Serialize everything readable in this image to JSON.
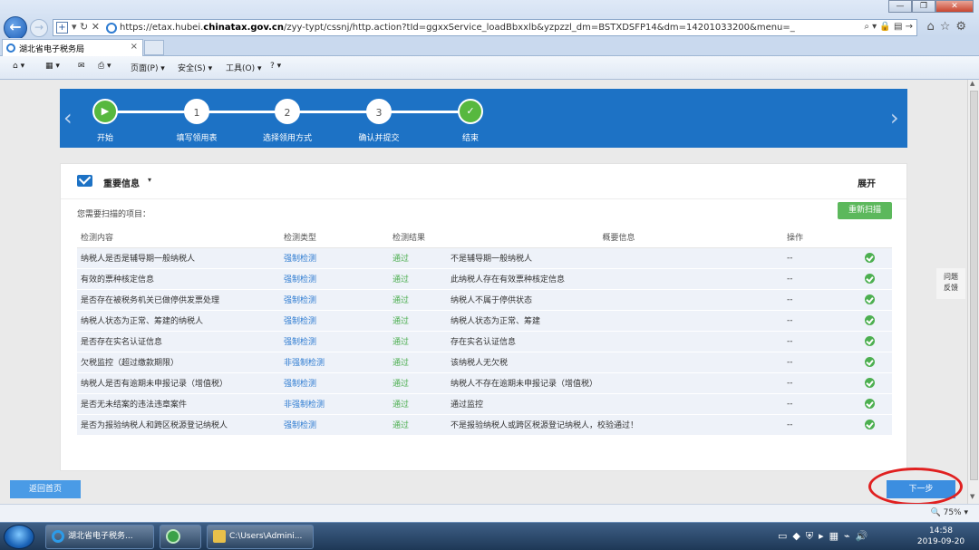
{
  "browser": {
    "url_prefix": "https://etax.hubei.",
    "url_domain": "chinatax.gov.cn",
    "url_suffix": "/zyy-typt/cssnj/http.action?tId=ggxxService_loadBbxxlb&yzpzzl_dm=BSTXDSFP14&dm=14201033200&menu=_",
    "tab_title": "湖北省电子税务局",
    "tab_close": "×",
    "commands": {
      "page": "页面(P) ▾",
      "safety": "安全(S) ▾",
      "tools": "工具(O) ▾"
    },
    "zoom": "75%"
  },
  "steps": [
    {
      "label": "开始",
      "marker": "▶",
      "state": "done"
    },
    {
      "label": "填写领用表",
      "marker": "1",
      "state": "todo"
    },
    {
      "label": "选择领用方式",
      "marker": "2",
      "state": "todo"
    },
    {
      "label": "确认并提交",
      "marker": "3",
      "state": "todo"
    },
    {
      "label": "结束",
      "marker": "✓",
      "state": "done"
    }
  ],
  "section": {
    "title": "重要信息",
    "caret": "▾",
    "expand": "展开",
    "scan_label": "您需要扫描的项目：",
    "rescan_button": "重新扫描"
  },
  "table": {
    "headers": {
      "content": "检测内容",
      "type": "检测类型",
      "result": "检测结果",
      "summary": "概要信息",
      "action": "操作"
    },
    "rows": [
      {
        "content": "纳税人是否是辅导期一般纳税人",
        "type": "强制检测",
        "result": "通过",
        "summary": "不是辅导期一般纳税人",
        "action": "--"
      },
      {
        "content": "有效的票种核定信息",
        "type": "强制检测",
        "result": "通过",
        "summary": "此纳税人存在有效票种核定信息",
        "action": "--"
      },
      {
        "content": "是否存在被税务机关已做停供发票处理",
        "type": "强制检测",
        "result": "通过",
        "summary": "纳税人不属于停供状态",
        "action": "--"
      },
      {
        "content": "纳税人状态为正常、筹建的纳税人",
        "type": "强制检测",
        "result": "通过",
        "summary": "纳税人状态为正常、筹建",
        "action": "--"
      },
      {
        "content": "是否存在实名认证信息",
        "type": "强制检测",
        "result": "通过",
        "summary": "存在实名认证信息",
        "action": "--"
      },
      {
        "content": "欠税监控（超过缴款期限）",
        "type": "非强制检测",
        "result": "通过",
        "summary": "该纳税人无欠税",
        "action": "--"
      },
      {
        "content": "纳税人是否有逾期未申报记录（增值税）",
        "type": "强制检测",
        "result": "通过",
        "summary": "纳税人不存在逾期未申报记录（增值税）",
        "action": "--"
      },
      {
        "content": "是否无未结案的违法违章案件",
        "type": "非强制检测",
        "result": "通过",
        "summary": "通过监控",
        "action": "--"
      },
      {
        "content": "是否为报验纳税人和跨区税源登记纳税人",
        "type": "强制检测",
        "result": "通过",
        "summary": "不是报验纳税人或跨区税源登记纳税人，校验通过！",
        "action": "--"
      }
    ]
  },
  "feedback": {
    "line1": "问题",
    "line2": "反馈"
  },
  "footer": {
    "back_home": "返回首页",
    "next": "下一步"
  },
  "taskbar": {
    "ie_item": "湖北省电子税务...",
    "folder_item": "C:\\Users\\Admini...",
    "time": "14:58",
    "date": "2019-09-20"
  },
  "colors": {
    "accent": "#1d72c5",
    "success": "#4caf50",
    "highlight_circle": "#e02020"
  }
}
